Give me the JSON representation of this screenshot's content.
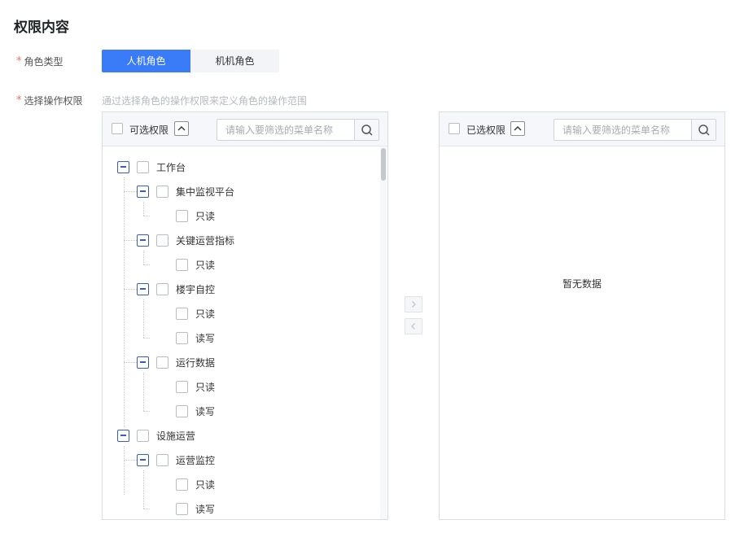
{
  "section_title": "权限内容",
  "role_type": {
    "label": "角色类型",
    "required_mark": "*",
    "options": [
      "人机角色",
      "机机角色"
    ],
    "selected": "人机角色"
  },
  "operation_permission": {
    "label": "选择操作权限",
    "required_mark": "*",
    "hint": "通过选择角色的操作权限来定义角色的操作范围"
  },
  "available_panel": {
    "title": "可选权限",
    "search_placeholder": "请输入要筛选的菜单名称",
    "tree": [
      {
        "label": "工作台",
        "level": 0,
        "expandable": true
      },
      {
        "label": "集中监视平台",
        "level": 1,
        "expandable": true
      },
      {
        "label": "只读",
        "level": 2,
        "expandable": false
      },
      {
        "label": "关键运营指标",
        "level": 1,
        "expandable": true
      },
      {
        "label": "只读",
        "level": 2,
        "expandable": false
      },
      {
        "label": "楼宇自控",
        "level": 1,
        "expandable": true
      },
      {
        "label": "只读",
        "level": 2,
        "expandable": false
      },
      {
        "label": "读写",
        "level": 2,
        "expandable": false
      },
      {
        "label": "运行数据",
        "level": 1,
        "expandable": true
      },
      {
        "label": "只读",
        "level": 2,
        "expandable": false
      },
      {
        "label": "读写",
        "level": 2,
        "expandable": false
      },
      {
        "label": "设施运营",
        "level": 0,
        "expandable": true
      },
      {
        "label": "运营监控",
        "level": 1,
        "expandable": true
      },
      {
        "label": "只读",
        "level": 2,
        "expandable": false
      },
      {
        "label": "读写",
        "level": 2,
        "expandable": false
      }
    ]
  },
  "selected_panel": {
    "title": "已选权限",
    "search_placeholder": "请输入要筛选的菜单名称",
    "empty_text": "暂无数据"
  },
  "transfer_buttons": {
    "to_right_icon": "chevron-right-icon",
    "to_left_icon": "chevron-left-icon"
  },
  "colors": {
    "primary": "#3a7bf7",
    "required": "#f56c6c",
    "tree_expand": "#3a5bc7"
  }
}
